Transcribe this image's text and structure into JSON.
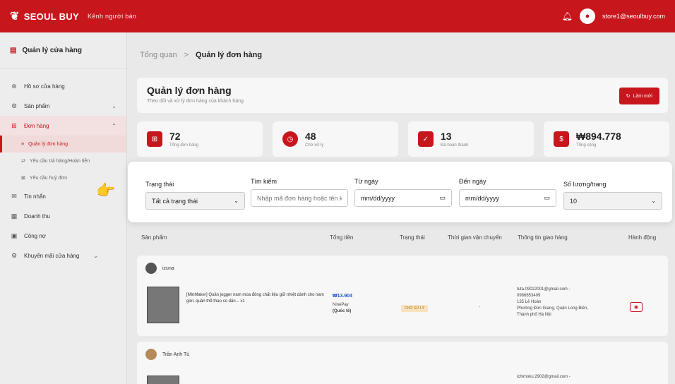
{
  "topbar": {
    "brand": "SEOUL BUY",
    "subtitle": "Kênh người bán",
    "user_email": "store1@seoulbuy.com",
    "accent": "#c8161d"
  },
  "sidebar": {
    "header": "Quản lý cửa hàng",
    "items": [
      {
        "label": "Hồ sơ cửa hàng",
        "icon": "store-icon"
      },
      {
        "label": "Sản phẩm",
        "icon": "box-icon"
      },
      {
        "label": "Đơn hàng",
        "icon": "cart-icon"
      },
      {
        "label": "Tin nhắn",
        "icon": "chat-icon"
      },
      {
        "label": "Doanh thu",
        "icon": "chart-icon"
      },
      {
        "label": "Công nợ",
        "icon": "wallet-icon"
      },
      {
        "label": "Khuyến mãi cửa hàng",
        "icon": "tag-icon"
      }
    ],
    "order_sub": [
      {
        "label": "Quản lý đơn hàng"
      },
      {
        "label": "Yêu cầu trả hàng/Hoàn tiền"
      },
      {
        "label": "Yêu cầu huỷ đơn"
      }
    ]
  },
  "breadcrumb": {
    "home": "Tổng quan",
    "sep": ">",
    "current": "Quản lý đơn hàng"
  },
  "page": {
    "title": "Quản lý đơn hàng",
    "subtitle": "Theo dõi và xử lý đơn hàng của khách hàng",
    "refresh_label": "Làm mới"
  },
  "stats": [
    {
      "value": "72",
      "label": "Tổng đơn hàng",
      "icon": "cart-icon"
    },
    {
      "value": "48",
      "label": "Chờ xử lý",
      "icon": "clock-icon"
    },
    {
      "value": "13",
      "label": "Đã hoàn thành",
      "icon": "check-icon"
    },
    {
      "value": "₩894.778",
      "label": "Tổng cộng",
      "icon": "dollar-icon"
    }
  ],
  "filters": {
    "status": {
      "label": "Trạng thái",
      "value": "Tất cả trạng thái"
    },
    "search": {
      "label": "Tìm kiếm",
      "placeholder": "Nhập mã đơn hàng hoặc tên khá"
    },
    "from_date": {
      "label": "Từ ngày",
      "value": "mm/dd/yyyy"
    },
    "to_date": {
      "label": "Đến ngày",
      "value": "mm/dd/yyyy"
    },
    "per_page": {
      "label": "Số lượng/trang",
      "value": "10"
    }
  },
  "table": {
    "columns": [
      "Sản phẩm",
      "Tổng tiền",
      "Trạng thái",
      "Thời gian vận chuyển",
      "Thông tin giao hàng",
      "Hành động"
    ]
  },
  "orders": [
    {
      "buyer": "izuna",
      "product": "[MinMaker] Quần jogger nam mùa đông chất liệu giữ nhiệt dành cho nam giới, quần thể thao co dãn... x1",
      "total": "₩13.904",
      "payment": "NinePay",
      "payment_type": "(Quốc tế)",
      "status": "CHỜ XỬ LÝ",
      "shipping_time": "-",
      "ship_email": "tuta.09022001@gmail.com -",
      "ship_phone": "0986653409",
      "ship_addr1": "135 Lê Hoàn",
      "ship_addr2": "Phường Đức Giang, Quận Long Biên,",
      "ship_addr3": "Thành phố Hà Nội"
    },
    {
      "buyer": "Trần Anh Tú",
      "ship_email": "ichimoku.2902@gmail.com -"
    }
  ]
}
